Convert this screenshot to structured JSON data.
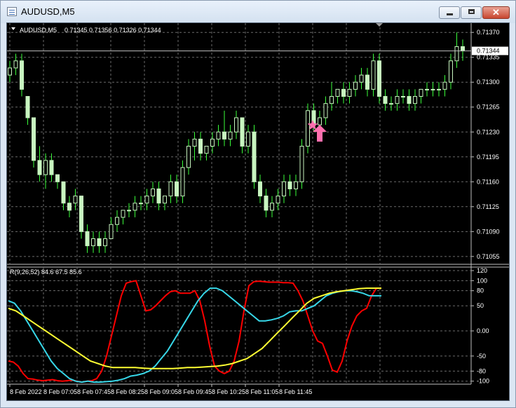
{
  "window": {
    "title": "AUDUSD,M5",
    "icon": "chart-window-icon",
    "buttons": {
      "minimize": "minimize-icon",
      "maximize": "maximize-icon",
      "close": "✕"
    }
  },
  "chart_header": {
    "symbol": "AUDUSD,M5",
    "ohlc": "0.71345 0.71356 0.71326 0.71344"
  },
  "indicator_header": "R(9,26,52) 84.6 67.5 85.6",
  "colors": {
    "background": "#000000",
    "grid": "#6b6b6b",
    "bull_body": "#c8f5c0",
    "bear_body": "#c8f5c0",
    "wick": "#3aff3a",
    "current_price_line": "#bfbfbf",
    "red_line": "#ff0000",
    "cyan_line": "#37d7e8",
    "yellow_line": "#ffff33",
    "signal": "#ff6fae"
  },
  "chart_data": [
    {
      "type": "candlestick",
      "ylim": [
        0.71044,
        0.71383
      ],
      "current_price": "0.71344",
      "y_ticks": [
        "0.71370",
        "0.71335",
        "0.71300",
        "0.71265",
        "0.71230",
        "0.71195",
        "0.71160",
        "0.71125",
        "0.71090",
        "0.71055"
      ],
      "candles": [
        [
          0.7131,
          0.7133,
          0.713,
          0.7132
        ],
        [
          0.7132,
          0.7134,
          0.7131,
          0.7133
        ],
        [
          0.7133,
          0.7134,
          0.7128,
          0.7129
        ],
        [
          0.7128,
          0.7128,
          0.7124,
          0.7125
        ],
        [
          0.7125,
          0.7125,
          0.7118,
          0.7119
        ],
        [
          0.7119,
          0.7121,
          0.7116,
          0.7117
        ],
        [
          0.7117,
          0.712,
          0.7115,
          0.7119
        ],
        [
          0.7119,
          0.712,
          0.7116,
          0.7117
        ],
        [
          0.7117,
          0.7117,
          0.7115,
          0.7116
        ],
        [
          0.7116,
          0.7116,
          0.7112,
          0.7113
        ],
        [
          0.7113,
          0.7114,
          0.7111,
          0.7112
        ],
        [
          0.7113,
          0.7115,
          0.7112,
          0.7114
        ],
        [
          0.7114,
          0.7114,
          0.7108,
          0.7109
        ],
        [
          0.7109,
          0.711,
          0.7106,
          0.7107
        ],
        [
          0.7107,
          0.7109,
          0.7106,
          0.7108
        ],
        [
          0.7108,
          0.7109,
          0.7106,
          0.7107
        ],
        [
          0.7107,
          0.7109,
          0.7106,
          0.7108
        ],
        [
          0.7108,
          0.7111,
          0.7108,
          0.711
        ],
        [
          0.711,
          0.7112,
          0.7109,
          0.7111
        ],
        [
          0.7111,
          0.7112,
          0.711,
          0.7112
        ],
        [
          0.7112,
          0.7113,
          0.7111,
          0.7112
        ],
        [
          0.7112,
          0.7114,
          0.7111,
          0.7113
        ],
        [
          0.7113,
          0.7114,
          0.7112,
          0.7113
        ],
        [
          0.7113,
          0.7115,
          0.7112,
          0.7114
        ],
        [
          0.7114,
          0.7116,
          0.7113,
          0.7115
        ],
        [
          0.7115,
          0.7116,
          0.7112,
          0.7113
        ],
        [
          0.7113,
          0.7114,
          0.7112,
          0.7114
        ],
        [
          0.7114,
          0.7117,
          0.7113,
          0.7116
        ],
        [
          0.7116,
          0.7117,
          0.7113,
          0.7114
        ],
        [
          0.7114,
          0.7119,
          0.7113,
          0.7118
        ],
        [
          0.7118,
          0.7122,
          0.7117,
          0.7121
        ],
        [
          0.7121,
          0.7123,
          0.7119,
          0.7122
        ],
        [
          0.7122,
          0.7123,
          0.7119,
          0.712
        ],
        [
          0.712,
          0.7121,
          0.7119,
          0.7121
        ],
        [
          0.7121,
          0.7123,
          0.712,
          0.7122
        ],
        [
          0.7122,
          0.7124,
          0.7121,
          0.7123
        ],
        [
          0.7123,
          0.7126,
          0.7121,
          0.7122
        ],
        [
          0.7122,
          0.7124,
          0.7121,
          0.7123
        ],
        [
          0.7123,
          0.7126,
          0.7122,
          0.7125
        ],
        [
          0.7125,
          0.7125,
          0.712,
          0.7121
        ],
        [
          0.7121,
          0.7124,
          0.712,
          0.7123
        ],
        [
          0.7123,
          0.7124,
          0.7115,
          0.7116
        ],
        [
          0.7116,
          0.7117,
          0.7113,
          0.7114
        ],
        [
          0.7114,
          0.7115,
          0.7111,
          0.7112
        ],
        [
          0.7112,
          0.7114,
          0.7111,
          0.7113
        ],
        [
          0.7113,
          0.7115,
          0.7112,
          0.7114
        ],
        [
          0.7114,
          0.7117,
          0.7113,
          0.7116
        ],
        [
          0.7116,
          0.7117,
          0.7114,
          0.7115
        ],
        [
          0.7115,
          0.7117,
          0.7114,
          0.7116
        ],
        [
          0.7116,
          0.7122,
          0.7115,
          0.7121
        ],
        [
          0.7121,
          0.7127,
          0.712,
          0.7126
        ],
        [
          0.7126,
          0.7127,
          0.7123,
          0.7124
        ],
        [
          0.7124,
          0.7126,
          0.7123,
          0.7125
        ],
        [
          0.7125,
          0.7128,
          0.7124,
          0.7127
        ],
        [
          0.7127,
          0.713,
          0.7126,
          0.7128
        ],
        [
          0.7128,
          0.7129,
          0.7127,
          0.7129
        ],
        [
          0.7129,
          0.713,
          0.7127,
          0.7128
        ],
        [
          0.7128,
          0.713,
          0.7127,
          0.7129
        ],
        [
          0.7129,
          0.7131,
          0.7128,
          0.713
        ],
        [
          0.713,
          0.7132,
          0.7129,
          0.7131
        ],
        [
          0.7131,
          0.7132,
          0.7128,
          0.7129
        ],
        [
          0.7129,
          0.7134,
          0.7128,
          0.7133
        ],
        [
          0.7133,
          0.7134,
          0.7127,
          0.7128
        ],
        [
          0.7128,
          0.7129,
          0.7126,
          0.7127
        ],
        [
          0.7127,
          0.7128,
          0.7126,
          0.7127
        ],
        [
          0.7127,
          0.7129,
          0.7126,
          0.7128
        ],
        [
          0.7128,
          0.7129,
          0.7127,
          0.7128
        ],
        [
          0.7128,
          0.7129,
          0.7126,
          0.7127
        ],
        [
          0.7127,
          0.7129,
          0.7126,
          0.7128
        ],
        [
          0.7128,
          0.7129,
          0.7127,
          0.7129
        ],
        [
          0.7129,
          0.713,
          0.7128,
          0.7129
        ],
        [
          0.7129,
          0.713,
          0.7128,
          0.7129
        ],
        [
          0.7129,
          0.713,
          0.7128,
          0.7129
        ],
        [
          0.7129,
          0.7131,
          0.7128,
          0.713
        ],
        [
          0.713,
          0.7134,
          0.7129,
          0.7133
        ],
        [
          0.7133,
          0.7137,
          0.7132,
          0.7135
        ],
        [
          0.7135,
          0.7136,
          0.7133,
          0.71344
        ]
      ]
    },
    {
      "type": "line",
      "ylim": [
        -106,
        127
      ],
      "y_ticks": [
        "120",
        "100",
        "80",
        "50",
        "0.00",
        "-50",
        "-80",
        "-100"
      ],
      "x_ticks": [
        "8 Feb 2022",
        "8 Feb 07:05",
        "8 Feb 07:45",
        "8 Feb 08:25",
        "8 Feb 09:05",
        "8 Feb 09:45",
        "8 Feb 10:25",
        "8 Feb 11:05",
        "8 Feb 11:45"
      ],
      "series": [
        {
          "color": "#ff0000",
          "values": [
            -60,
            -62,
            -70,
            -85,
            -95,
            -96,
            -98,
            -99,
            -98,
            -97,
            -99,
            -100,
            -99,
            -98,
            -100,
            -102,
            -100,
            -99,
            -95,
            -80,
            -50,
            -10,
            30,
            70,
            95,
            98,
            100,
            70,
            40,
            42,
            50,
            60,
            70,
            78,
            80,
            75,
            75,
            75,
            80,
            60,
            20,
            -30,
            -70,
            -80,
            -85,
            -80,
            -60,
            -20,
            40,
            90,
            98,
            99,
            98,
            97,
            97,
            97,
            96,
            96,
            95,
            80,
            60,
            30,
            0,
            -20,
            -25,
            -50,
            -78,
            -82,
            -60,
            -20,
            10,
            30,
            40,
            45,
            70,
            85,
            85
          ]
        },
        {
          "color": "#37d7e8",
          "values": [
            60,
            55,
            40,
            20,
            0,
            -20,
            -40,
            -60,
            -75,
            -85,
            -95,
            -100,
            -102,
            -100,
            -102,
            -102,
            -101,
            -100,
            -98,
            -95,
            -90,
            -88,
            -85,
            -80,
            -70,
            -55,
            -40,
            -20,
            0,
            20,
            40,
            60,
            75,
            85,
            85,
            80,
            70,
            60,
            50,
            40,
            30,
            20,
            20,
            22,
            25,
            30,
            38,
            40,
            40,
            45,
            50,
            60,
            70,
            75,
            78,
            80,
            80,
            78,
            75,
            70,
            70,
            70
          ]
        },
        {
          "color": "#ffff33",
          "values": [
            45,
            40,
            30,
            20,
            10,
            0,
            -10,
            -20,
            -30,
            -40,
            -50,
            -60,
            -65,
            -70,
            -73,
            -73,
            -73,
            -73,
            -74,
            -75,
            -75,
            -75,
            -75,
            -74,
            -73,
            -73,
            -72,
            -71,
            -70,
            -68,
            -65,
            -60,
            -55,
            -45,
            -35,
            -20,
            -5,
            10,
            25,
            40,
            55,
            65,
            70,
            75,
            78,
            80,
            82,
            84,
            85,
            85,
            85
          ]
        }
      ]
    }
  ]
}
